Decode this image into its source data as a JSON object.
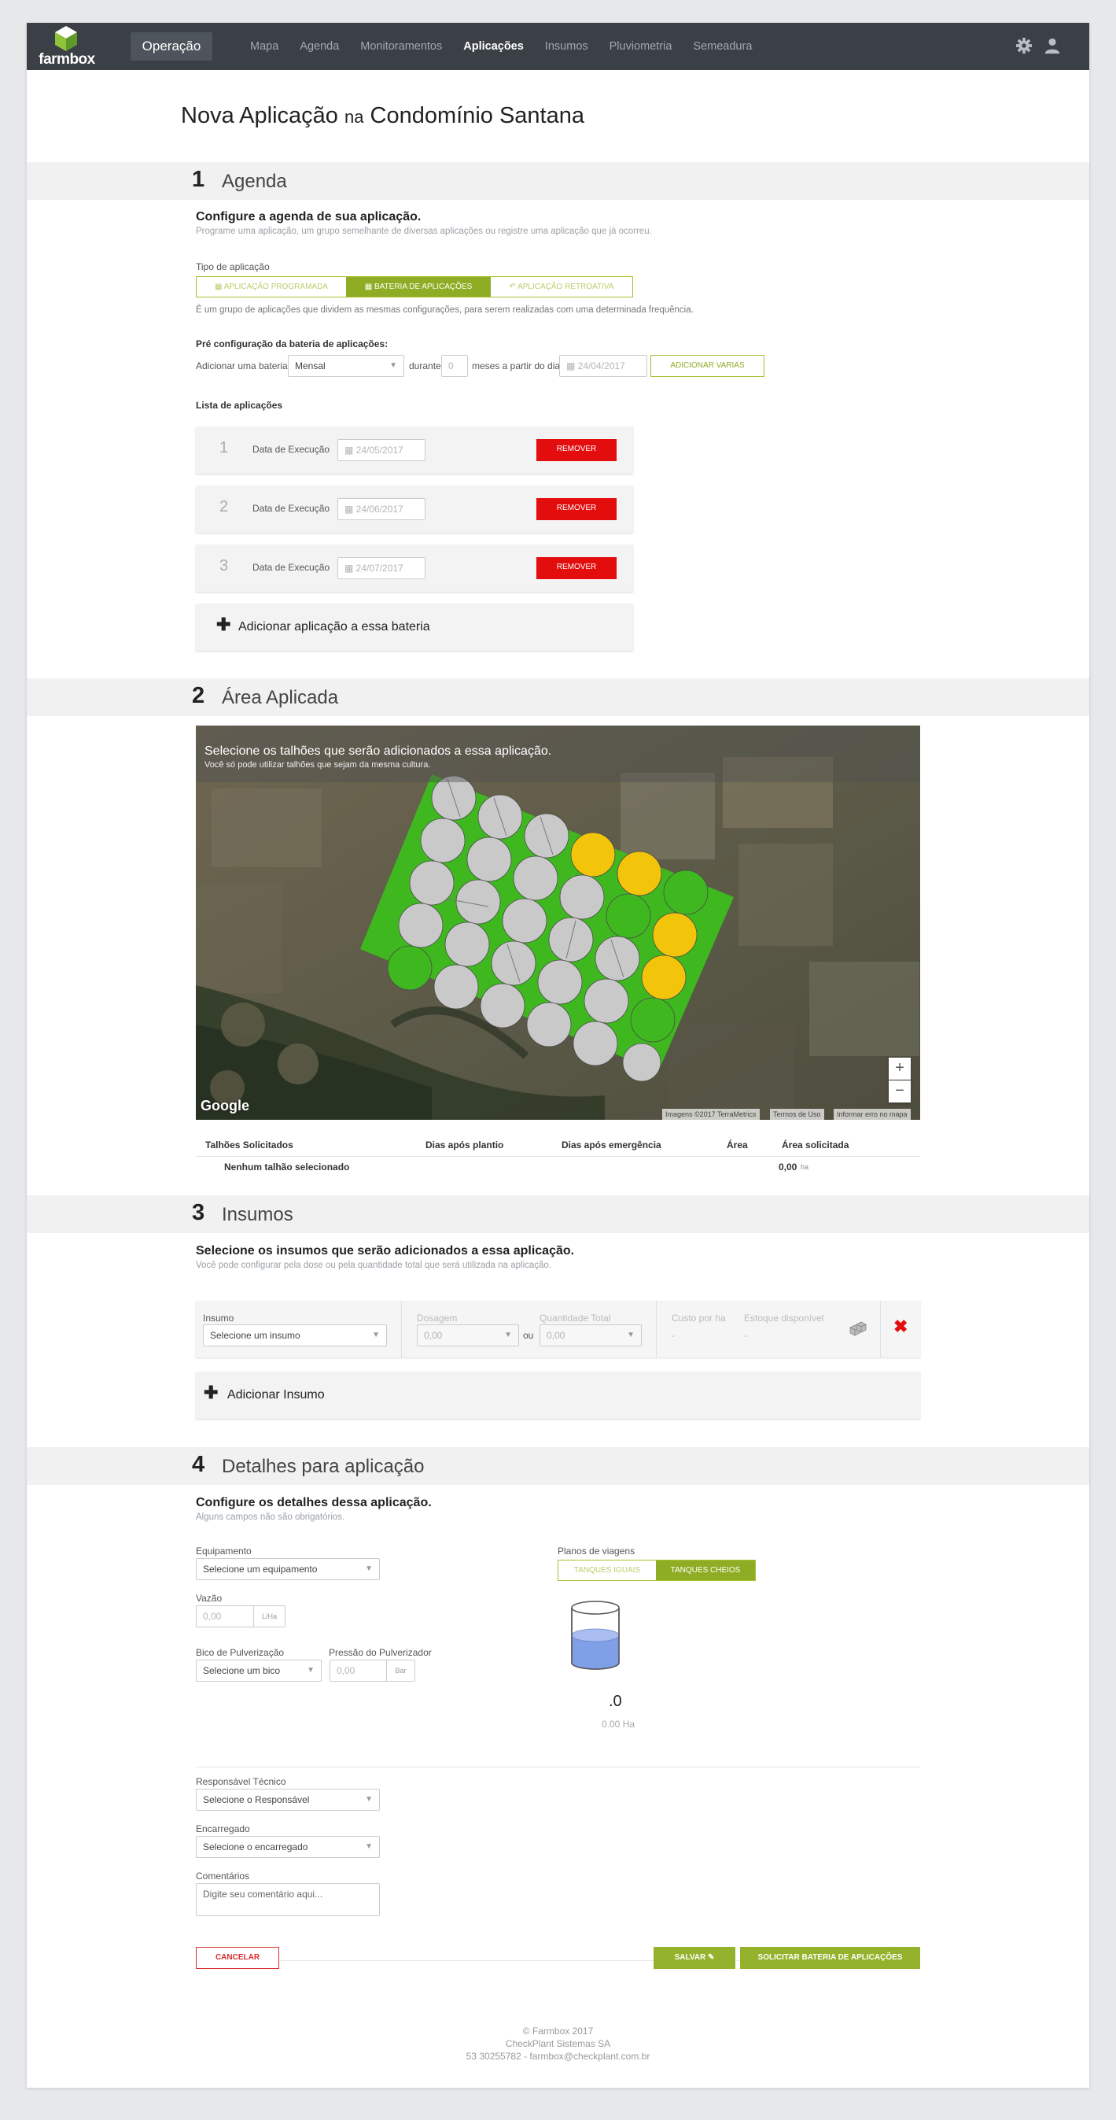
{
  "nav": {
    "logo_text": "farmbox",
    "context_label": "Operação",
    "items": [
      {
        "label": "Mapa",
        "active": false
      },
      {
        "label": "Agenda",
        "active": false
      },
      {
        "label": "Monitoramentos",
        "active": false
      },
      {
        "label": "Aplicações",
        "active": true
      },
      {
        "label": "Insumos",
        "active": false
      },
      {
        "label": "Pluviometria",
        "active": false
      },
      {
        "label": "Semeadura",
        "active": false
      }
    ],
    "icons": [
      "gear-icon",
      "user-icon"
    ]
  },
  "page": {
    "title_part1": "Nova Aplicação",
    "title_part2": "na",
    "title_part3": "Condomínio Santana"
  },
  "section1": {
    "number": "1",
    "title": "Agenda",
    "heading": "Configure a agenda de sua aplicação.",
    "description": "Programe uma aplicação, um grupo semelhante de diversas aplicações ou registre uma aplicação que já ocorreu.",
    "type_label": "Tipo de aplicação",
    "type_options": [
      {
        "label": "Aplicação Programada",
        "selected": false
      },
      {
        "label": "Bateria de Aplicações",
        "selected": true
      },
      {
        "label": "Aplicação Retroativa",
        "selected": false
      }
    ],
    "type_help": "É um grupo de aplicações que dividem as mesmas configurações, para serem realizadas com uma determinada frequência.",
    "preconfig_label": "Pré configuração da bateria de aplicações:",
    "add_battery_label": "Adicionar uma bateria",
    "frequency_value": "Mensal",
    "during_label": "durante",
    "count_placeholder": "0",
    "months_from_label": "meses a partir do dia",
    "start_date_placeholder": "24/04/2017",
    "add_several_label": "ADICIONAR VARIAS",
    "list_label": "Lista de aplicações",
    "applications": [
      {
        "number": "1",
        "label": "Data de Execução",
        "date": "24/05/2017",
        "remove_label": "REMOVER"
      },
      {
        "number": "2",
        "label": "Data de Execução",
        "date": "24/06/2017",
        "remove_label": "REMOVER"
      },
      {
        "number": "3",
        "label": "Data de Execução",
        "date": "24/07/2017",
        "remove_label": "REMOVER"
      }
    ],
    "add_application_label": "Adicionar aplicação a essa bateria"
  },
  "section2": {
    "number": "2",
    "title": "Área Aplicada",
    "map_title": "Selecione os talhões que serão adicionados a essa aplicação.",
    "map_subtitle": "Você só pode utilizar talhões que sejam da mesma cultura.",
    "map_attribution": "Imagens ©2017 TerraMetrics",
    "map_terms": "Termos de Uso",
    "map_report": "Informar erro no mapa",
    "map_brand": "Google",
    "zoom_in": "+",
    "zoom_out": "−",
    "table_headers": [
      "Talhões Solicitados",
      "Dias após plantio",
      "Dias após emergência",
      "Área",
      "Área solicitada"
    ],
    "empty_row": "Nenhum talhão selecionado",
    "total_area": "0,00",
    "total_unit": "ha",
    "colors": {
      "field_green": "#3fb81f",
      "pivot_gray": "#c9c9c9",
      "pivot_yellow": "#f2c40a"
    }
  },
  "section3": {
    "number": "3",
    "title": "Insumos",
    "heading": "Selecione os insumos que serão adicionados a essa aplicação.",
    "description": "Você pode configurar pela dose ou pela quantidade total que será utilizada na aplicação.",
    "insumo_label": "Insumo",
    "insumo_placeholder": "Selecione um insumo",
    "dosage_label": "Dosagem",
    "dosage_value": "0,00",
    "or_label": "ou",
    "total_label": "Quantidade Total",
    "total_value": "0,00",
    "cost_label": "Custo por ha",
    "cost_value": "-",
    "stock_label": "Estoque disponível",
    "stock_value": "-",
    "add_insumo_label": "Adicionar Insumo"
  },
  "section4": {
    "number": "4",
    "title": "Detalhes para aplicação",
    "heading": "Configure os detalhes dessa aplicação.",
    "description": "Alguns campos não são obrigatórios.",
    "equipment_label": "Equipamento",
    "equipment_placeholder": "Selecione um equipamento",
    "flow_label": "Vazão",
    "flow_placeholder": "0,00",
    "flow_unit": "L/Ha",
    "nozzle_label": "Bico de Pulverização",
    "nozzle_placeholder": "Selecione um bico",
    "pressure_label": "Pressão do Pulverizador",
    "pressure_placeholder": "0,00",
    "pressure_unit": "Bar",
    "trip_plans_label": "Planos de viagens",
    "trip_options": [
      {
        "label": "TANQUES IGUAIS",
        "selected": false
      },
      {
        "label": "TANQUES CHEIOS",
        "selected": true
      }
    ],
    "tank_count": ".0",
    "tank_area": "0.00 Ha",
    "tank_fill_fraction": 0.5,
    "responsible_label": "Responsável Técnico",
    "responsible_placeholder": "Selecione o Responsável",
    "in_charge_label": "Encarregado",
    "in_charge_placeholder": "Selecione o encarregado",
    "comments_label": "Comentários",
    "comments_placeholder": "Digite seu comentário aqui...",
    "cancel_label": "CANCELAR",
    "save_label": "SALVAR",
    "request_label": "SOLICITAR BATERIA DE APLICAÇÕES"
  },
  "footer": {
    "line1": "© Farmbox 2017",
    "line2": "CheckPlant Sistemas SA",
    "line3": "53 30255782 - farmbox@checkplant.com.br"
  }
}
